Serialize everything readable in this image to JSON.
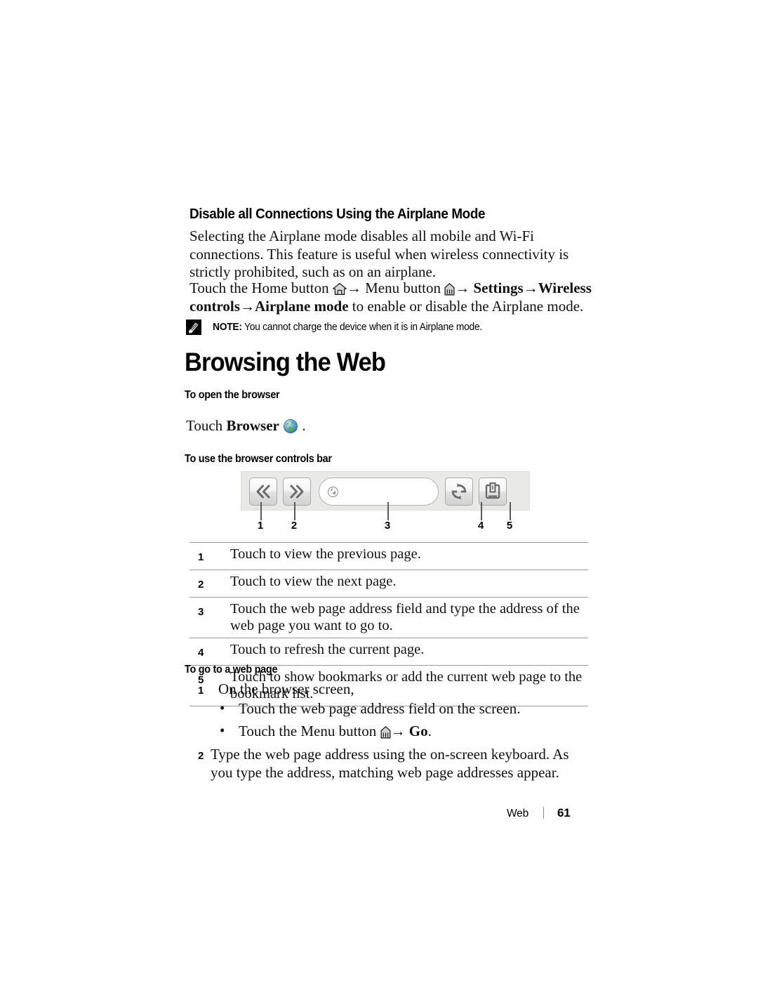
{
  "document": {
    "section_heading": "Disable all Connections Using the Airplane Mode",
    "intro_paragraph": "Selecting the Airplane mode disables all mobile and Wi-Fi connections. This feature is useful when wireless connectivity is strictly prohibited, such as on an airplane.",
    "airplane_path": {
      "part1": "Touch the Home button ",
      "part2": " Menu button ",
      "part3": " ",
      "settings_bold": "Settings",
      "wireless_bold": "Wireless controls",
      "airplane_bold": "Airplane mode",
      "tail": " to enable or disable the Airplane mode.",
      "arrow": "→"
    },
    "note": {
      "label": "NOTE:",
      "text": " You cannot charge the device when it is in Airplane mode."
    },
    "chapter_heading": "Browsing the Web",
    "open_browser": {
      "heading": "To open the browser",
      "line_prefix": "Touch ",
      "line_bold": "Browser",
      "line_suffix": " ."
    },
    "controls_bar": {
      "heading": "To use the browser controls bar",
      "callouts": [
        "1",
        "2",
        "3",
        "4",
        "5"
      ],
      "buttons": {
        "back": "back-button",
        "forward": "forward-button",
        "address": "address-field",
        "refresh": "refresh-button",
        "bookmarks": "bookmarks-button"
      },
      "rows": [
        {
          "num": "1",
          "desc": "Touch to view the previous page."
        },
        {
          "num": "2",
          "desc": "Touch to view the next page."
        },
        {
          "num": "3",
          "desc": "Touch the web page address field and type the address of the web page you want to go to."
        },
        {
          "num": "4",
          "desc": "Touch to refresh the current page."
        },
        {
          "num": "5",
          "desc": "Touch to show bookmarks or add the current web page to the bookmark list."
        }
      ]
    },
    "goto_page": {
      "heading": "To go to a web page",
      "step1_num": "1",
      "step1_text": "On the browser screen,",
      "bullet_char": "•",
      "bullet1": "Touch the web page address field on the screen.",
      "bullet2_prefix": "Touch the Menu button ",
      "bullet2_arrow": "→",
      "bullet2_bold": "Go",
      "bullet2_suffix": ".",
      "step2_num": "2",
      "step2_text": "Type the web page address using the on-screen keyboard. As you type the address, matching web page addresses appear."
    },
    "footer": {
      "label": "Web",
      "page_number": "61"
    },
    "colors": {
      "text": "#111111",
      "rule": "#9a9a9a",
      "toolbar_bg": "#e9e9e7",
      "globe_blue": "#4a9fd4",
      "globe_green": "#5faa3c"
    }
  }
}
